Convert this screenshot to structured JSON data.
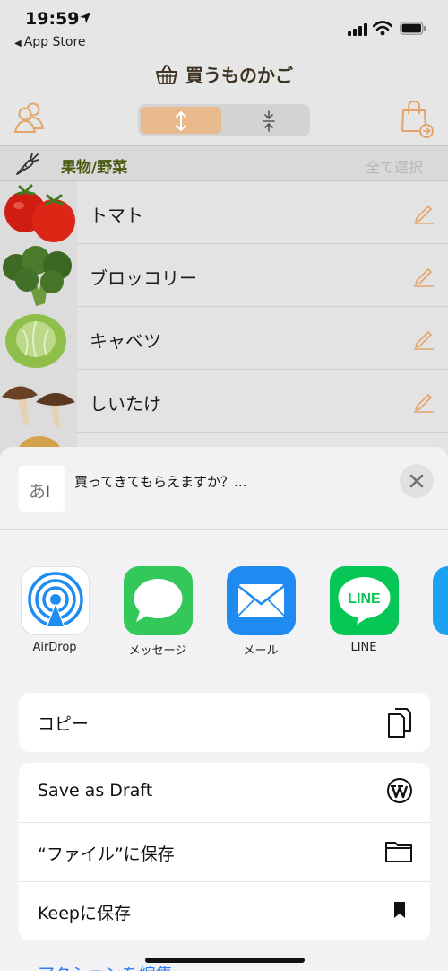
{
  "status_bar": {
    "time": "19:59",
    "back_label": "App Store"
  },
  "app": {
    "title": "買うものかご",
    "category": {
      "name": "果物/野菜",
      "select_all": "全て選択"
    },
    "items": [
      {
        "label": "トマト"
      },
      {
        "label": "ブロッコリー"
      },
      {
        "label": "キャベツ"
      },
      {
        "label": "しいたけ"
      }
    ]
  },
  "share_sheet": {
    "preview_thumb_text": "あ",
    "preview_text": "買ってきてもらえますか？...",
    "apps": [
      {
        "label": "AirDrop",
        "icon": "airdrop-icon"
      },
      {
        "label": "メッセージ",
        "icon": "messages-icon"
      },
      {
        "label": "メール",
        "icon": "mail-icon"
      },
      {
        "label": "LINE",
        "icon": "line-icon"
      }
    ],
    "line_icon_text": "LINE",
    "actions_group1": [
      {
        "label": "コピー",
        "icon": "copy-icon"
      }
    ],
    "actions_group2": [
      {
        "label": "Save as Draft",
        "icon": "wordpress-icon"
      },
      {
        "label": "“ファイル”に保存",
        "icon": "folder-icon"
      },
      {
        "label": "Keepに保存",
        "icon": "bookmark-icon"
      }
    ],
    "edit_actions": "アクションを編集..."
  },
  "colors": {
    "accent_orange": "#e8b98c",
    "category_green": "#4a5a10",
    "link_blue": "#2f7cf6"
  }
}
